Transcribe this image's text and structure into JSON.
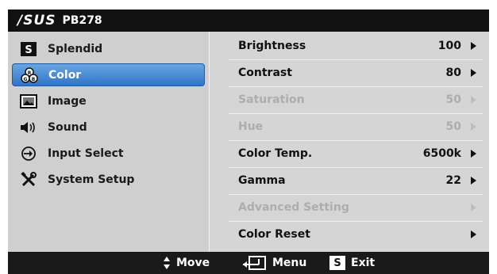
{
  "header": {
    "logo": "/SUS",
    "model": "PB278"
  },
  "menu": [
    {
      "label": "Splendid",
      "icon": "splendid-s-icon",
      "selected": false
    },
    {
      "label": "Color",
      "icon": "color-palette-icon",
      "selected": true
    },
    {
      "label": "Image",
      "icon": "image-icon",
      "selected": false
    },
    {
      "label": "Sound",
      "icon": "speaker-icon",
      "selected": false
    },
    {
      "label": "Input Select",
      "icon": "input-select-icon",
      "selected": false
    },
    {
      "label": "System Setup",
      "icon": "system-setup-tools-icon",
      "selected": false
    }
  ],
  "settings": [
    {
      "label": "Brightness",
      "value": "100",
      "enabled": true
    },
    {
      "label": "Contrast",
      "value": "80",
      "enabled": true
    },
    {
      "label": "Saturation",
      "value": "50",
      "enabled": false
    },
    {
      "label": "Hue",
      "value": "50",
      "enabled": false
    },
    {
      "label": "Color Temp.",
      "value": "6500k",
      "enabled": true
    },
    {
      "label": "Gamma",
      "value": "22",
      "enabled": true
    },
    {
      "label": "Advanced Setting",
      "value": "",
      "enabled": false
    },
    {
      "label": "Color Reset",
      "value": "",
      "enabled": true
    }
  ],
  "footer": {
    "move_label": "Move",
    "menu_label": "Menu",
    "exit_label": "Exit",
    "exit_key": "S"
  },
  "colors": {
    "selection": "#2e74c6",
    "panel": "#d5d5d5",
    "bar": "#1a1a1a",
    "disabled": "#adadad"
  }
}
